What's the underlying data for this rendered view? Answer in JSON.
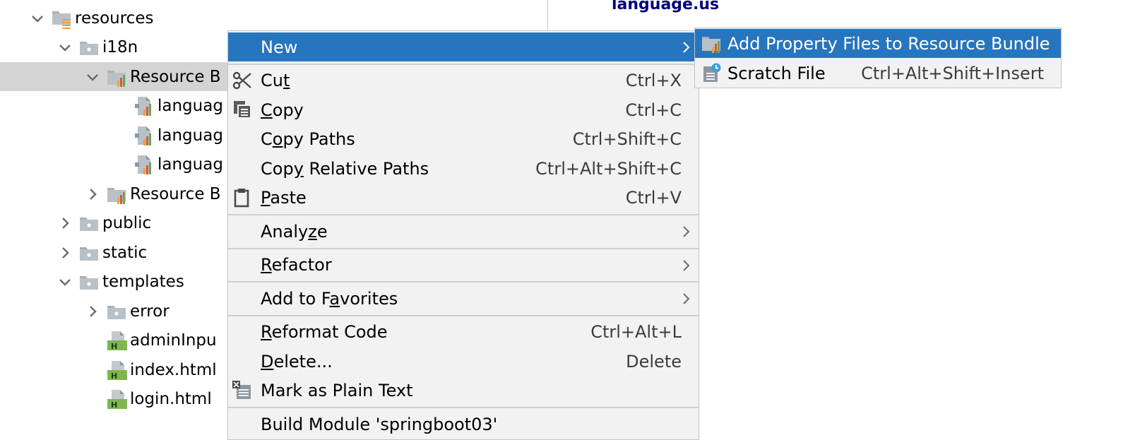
{
  "editor": {
    "visible_text": "language.us"
  },
  "tree": {
    "items": [
      {
        "label": "resources",
        "chevron": "down",
        "icon": "resources-folder-icon",
        "indent": 0
      },
      {
        "label": "i18n",
        "chevron": "down",
        "icon": "folder-icon",
        "indent": 1
      },
      {
        "label": "Resource B",
        "chevron": "down",
        "icon": "resource-bundle-icon",
        "indent": 2,
        "selected": true
      },
      {
        "label": "languag",
        "chevron": "none",
        "icon": "properties-file-icon",
        "indent": 3
      },
      {
        "label": "languag",
        "chevron": "none",
        "icon": "properties-file-icon",
        "indent": 3
      },
      {
        "label": "languag",
        "chevron": "none",
        "icon": "properties-file-icon",
        "indent": 3
      },
      {
        "label": "Resource B",
        "chevron": "right",
        "icon": "resource-bundle-icon",
        "indent": 2
      },
      {
        "label": "public",
        "chevron": "right",
        "icon": "folder-icon",
        "indent": 1
      },
      {
        "label": "static",
        "chevron": "right",
        "icon": "folder-icon",
        "indent": 1
      },
      {
        "label": "templates",
        "chevron": "down",
        "icon": "folder-icon",
        "indent": 1
      },
      {
        "label": "error",
        "chevron": "right",
        "icon": "folder-icon",
        "indent": 2
      },
      {
        "label": "adminInpu",
        "chevron": "none",
        "icon": "html-file-icon",
        "indent": 2
      },
      {
        "label": "index.html",
        "chevron": "none",
        "icon": "html-file-icon",
        "indent": 2
      },
      {
        "label": "login.html",
        "chevron": "none",
        "icon": "html-file-icon",
        "indent": 2
      }
    ]
  },
  "context_menu": {
    "items": [
      {
        "type": "item",
        "pre": "New",
        "u": "",
        "post": "",
        "shortcut": "",
        "submenu": true,
        "active": true,
        "icon": ""
      },
      {
        "type": "sep"
      },
      {
        "type": "item",
        "pre": "Cu",
        "u": "t",
        "post": "",
        "shortcut": "Ctrl+X",
        "icon": "scissors-icon"
      },
      {
        "type": "item",
        "pre": "",
        "u": "C",
        "post": "opy",
        "shortcut": "Ctrl+C",
        "icon": "copy-icon"
      },
      {
        "type": "item",
        "pre": "C",
        "u": "o",
        "post": "py Paths",
        "shortcut": "Ctrl+Shift+C",
        "icon": ""
      },
      {
        "type": "item",
        "pre": "Cop",
        "u": "y",
        "post": " Relative Paths",
        "shortcut": "Ctrl+Alt+Shift+C",
        "icon": ""
      },
      {
        "type": "item",
        "pre": "",
        "u": "P",
        "post": "aste",
        "shortcut": "Ctrl+V",
        "icon": "clipboard-icon"
      },
      {
        "type": "sep"
      },
      {
        "type": "item",
        "pre": "Analy",
        "u": "z",
        "post": "e",
        "shortcut": "",
        "submenu": true,
        "icon": ""
      },
      {
        "type": "sep"
      },
      {
        "type": "item",
        "pre": "",
        "u": "R",
        "post": "efactor",
        "shortcut": "",
        "submenu": true,
        "icon": ""
      },
      {
        "type": "sep"
      },
      {
        "type": "item",
        "pre": "Add to F",
        "u": "a",
        "post": "vorites",
        "shortcut": "",
        "submenu": true,
        "icon": ""
      },
      {
        "type": "sep"
      },
      {
        "type": "item",
        "pre": "",
        "u": "R",
        "post": "eformat Code",
        "shortcut": "Ctrl+Alt+L",
        "icon": ""
      },
      {
        "type": "item",
        "pre": "",
        "u": "D",
        "post": "elete...",
        "shortcut": "Delete",
        "icon": ""
      },
      {
        "type": "item",
        "pre": "Mark as Plain Text",
        "u": "",
        "post": "",
        "shortcut": "",
        "icon": "plain-text-icon"
      },
      {
        "type": "sep"
      },
      {
        "type": "item",
        "pre": "Build Module 'springboot03'",
        "u": "",
        "post": "",
        "shortcut": "",
        "icon": ""
      }
    ]
  },
  "submenu": {
    "items": [
      {
        "label": "Add Property Files to Resource Bundle",
        "shortcut": "",
        "active": true,
        "icon": "resource-bundle-icon"
      },
      {
        "label": "Scratch File",
        "shortcut": "Ctrl+Alt+Shift+Insert",
        "active": false,
        "icon": "scratch-file-icon"
      }
    ]
  },
  "colors": {
    "selection": "#2675bf",
    "tree_selected": "#d4d4d4",
    "menu_bg": "#f2f2f2",
    "editor_text": "#000080"
  }
}
